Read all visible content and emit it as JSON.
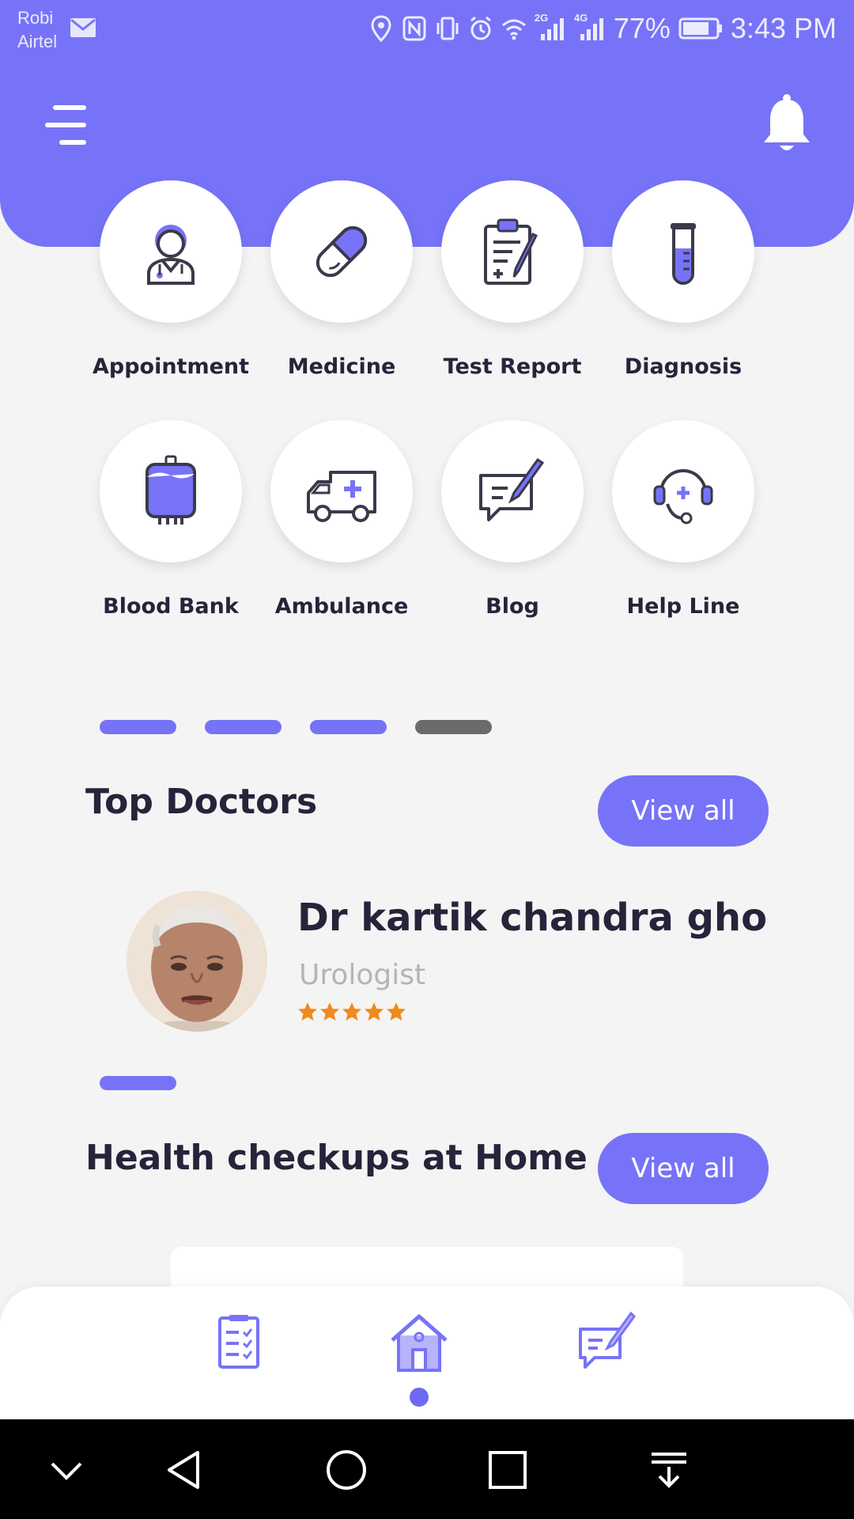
{
  "status_bar": {
    "carrier_line1": "Robi",
    "carrier_line2": "Airtel",
    "network_2g": "2G",
    "network_4g": "4G",
    "battery": "77%",
    "time": "3:43 PM"
  },
  "services": [
    {
      "label": "Appointment",
      "icon": "doctor-icon"
    },
    {
      "label": "Medicine",
      "icon": "pill-icon"
    },
    {
      "label": "Test Report",
      "icon": "clipboard-pen-icon"
    },
    {
      "label": "Diagnosis",
      "icon": "test-tube-icon"
    },
    {
      "label": "Blood Bank",
      "icon": "blood-bag-icon"
    },
    {
      "label": "Ambulance",
      "icon": "ambulance-icon"
    },
    {
      "label": "Blog",
      "icon": "chat-edit-icon"
    },
    {
      "label": "Help Line",
      "icon": "headset-icon"
    }
  ],
  "top_doctors": {
    "title": "Top Doctors",
    "view_all": "View all",
    "doctor": {
      "name": "Dr kartik chandra ghosh",
      "specialty": "Urologist",
      "rating": 5
    }
  },
  "health_checkups": {
    "title": "Health checkups at Home",
    "view_all": "View all"
  },
  "colors": {
    "accent": "#7773f8",
    "star": "#f08a1c",
    "text": "#26243a"
  }
}
